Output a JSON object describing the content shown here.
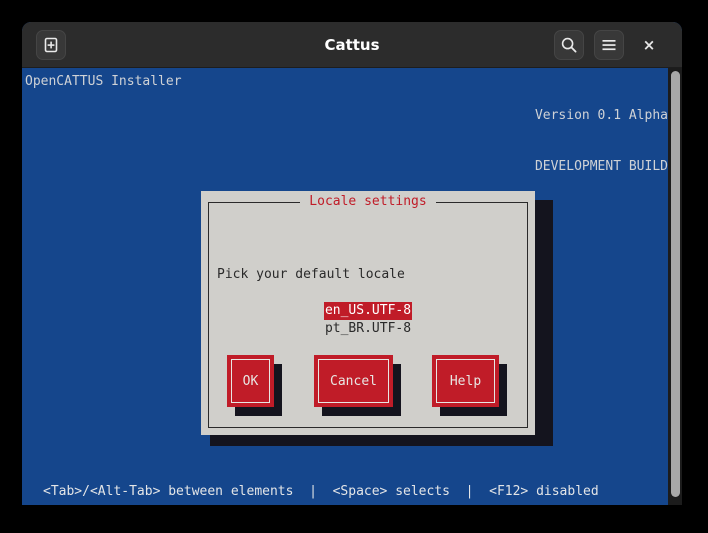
{
  "titlebar": {
    "title": "Cattus",
    "new_tab_icon": "add-tab-icon",
    "search_icon": "search-icon",
    "menu_icon": "hamburger-menu-icon",
    "close_icon": "close-icon",
    "close_glyph": "×"
  },
  "terminal": {
    "header_left": "OpenCATTUS Installer",
    "header_right_line1": "Version 0.1 Alpha",
    "header_right_line2": "DEVELOPMENT BUILD",
    "footer": "<Tab>/<Alt-Tab> between elements  |  <Space> selects  |  <F12> disabled",
    "background_color": "#15468c",
    "text_color": "#cfd2d6"
  },
  "dialog": {
    "title": "Locale settings",
    "title_color": "#c01c28",
    "prompt": "Pick your default locale",
    "background_color": "#d0cfcb",
    "accent_color": "#c01c28",
    "locales": [
      {
        "label": "en_US.UTF-8",
        "selected": true
      },
      {
        "label": "pt_BR.UTF-8",
        "selected": false
      }
    ],
    "buttons": [
      {
        "label": "OK"
      },
      {
        "label": "Cancel"
      },
      {
        "label": "Help"
      }
    ]
  }
}
